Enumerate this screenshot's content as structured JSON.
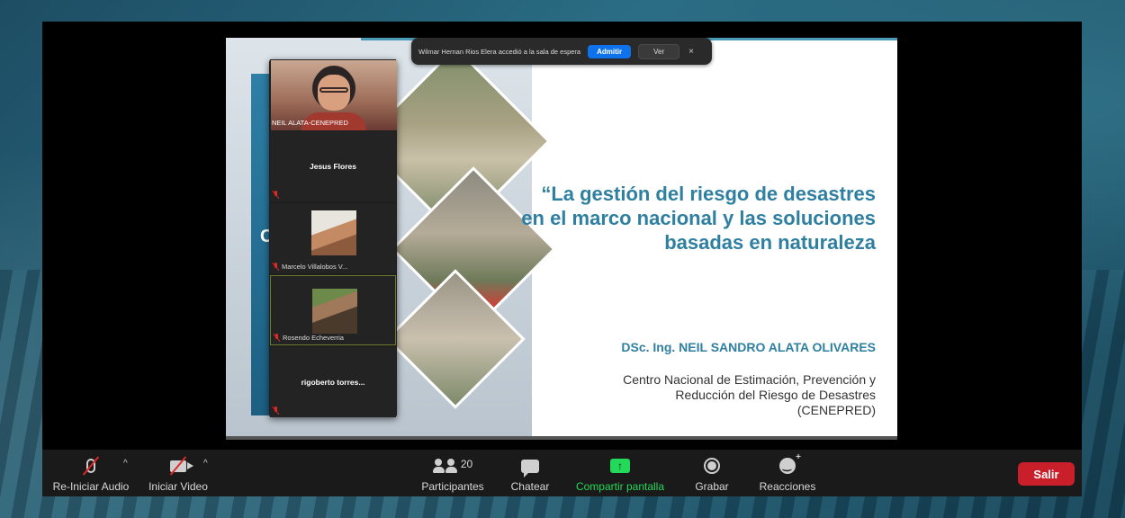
{
  "notification": {
    "text": "Wilmar Hernan Rios Elera accedió a la sala de espera",
    "admit_label": "Admitir",
    "view_label": "Ver",
    "close_symbol": "×"
  },
  "slide": {
    "title": "“La gestión del riesgo de desastres en el marco nacional y las soluciones basadas en naturaleza",
    "author": "DSc. Ing. NEIL SANDRO ALATA OLIVARES",
    "institution_line1": "Centro Nacional de Estimación, Prevención y",
    "institution_line2": "Reducción del Riesgo de Desastres",
    "institution_line3": "(CENEPRED)",
    "left_letter": "C"
  },
  "participants": {
    "tiles": [
      {
        "name": "NEIL ALATA-CENEPRED",
        "type": "video"
      },
      {
        "name": "Jesus Flores",
        "type": "name"
      },
      {
        "name": "Marcelo Villalobos V...",
        "type": "thumb"
      },
      {
        "name": "Rosendo Echeverria",
        "type": "thumb",
        "active": true
      },
      {
        "name": "rigoberto  torres...",
        "type": "name"
      }
    ]
  },
  "toolbar": {
    "audio_label": "Re-Iniciar Audio",
    "video_label": "Iniciar Video",
    "participants_label": "Participantes",
    "participants_count": "20",
    "chat_label": "Chatear",
    "share_label": "Compartir pantalla",
    "record_label": "Grabar",
    "reactions_label": "Reacciones",
    "leave_label": "Salir",
    "caret_symbol": "^",
    "share_arrow": "↑"
  },
  "colors": {
    "share_green": "#23d959",
    "leave_red": "#c91f2a",
    "admit_blue": "#0e72ed",
    "slide_title_blue": "#2f7fa0"
  }
}
